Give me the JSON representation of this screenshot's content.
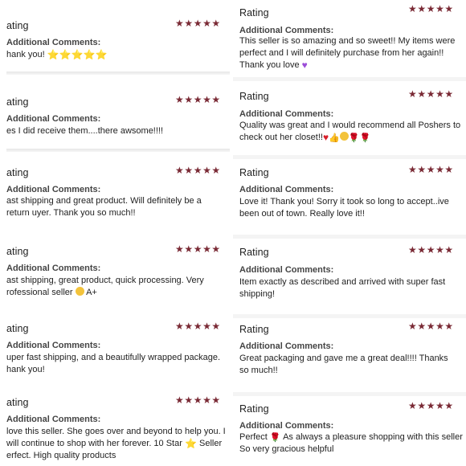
{
  "rating_label": "Rating",
  "additional_comments_label": "Additional Comments:",
  "stars": "★★★★★",
  "left_column": [
    {
      "text": "hank you!"
    },
    {
      "text": "es I did receive them....there awsome!!!!"
    },
    {
      "text": "ast shipping and great product. Will definitely be a return uyer. Thank you so much!!"
    },
    {
      "text": "ast shipping, great product, quick processing. Very rofessional seller",
      "tail": "A+"
    },
    {
      "text": "uper fast shipping, and a beautifully wrapped package. hank you!"
    },
    {
      "text_a": "love this seller. She goes over and beyond to help you. I will continue to shop with her forever. 10 Star",
      "text_b": "Seller erfect. High quality products"
    }
  ],
  "right_column": [
    {
      "text": "This seller is so amazing and so sweet!! My items were perfect and I will definitely purchase from her again!! Thank you love"
    },
    {
      "text": "Quality was great and I would recommend all Poshers to check out her closet!!"
    },
    {
      "text": "Love it! Thank you! Sorry it took so long to accept..ive been out of town. Really love it!!"
    },
    {
      "text": "Item exactly as described and arrived with super fast shipping!"
    },
    {
      "text": "Great packaging and gave me a great deal!!!! Thanks so much!!"
    },
    {
      "text_a": "Perfect",
      "text_b": "As always a pleasure shopping with this seller So very gracious helpful"
    }
  ],
  "rating_labels_left": [
    "ating",
    "ating",
    "ating",
    "ating",
    "ating",
    "ating"
  ],
  "colors": {
    "star": "#7a2a35",
    "text": "#222222",
    "label": "#444444"
  },
  "icons": [
    "star-emoji-icon",
    "purple-heart-icon",
    "red-heart-icon",
    "thumbs-up-icon",
    "smile-emoji-icon",
    "rose-icon",
    "grin-emoji-icon"
  ]
}
